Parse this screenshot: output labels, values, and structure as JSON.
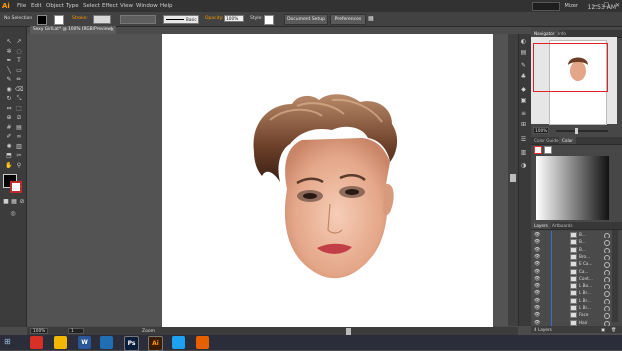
{
  "app": {
    "logo": "Ai",
    "accent": "#ff9a00"
  },
  "menu": [
    "File",
    "Edit",
    "Object",
    "Type",
    "Select",
    "Effect",
    "View",
    "Window",
    "Help"
  ],
  "user": {
    "name": "Mizer",
    "search_icon": "search-icon"
  },
  "window_controls": [
    "—",
    "☐",
    "✕"
  ],
  "control_bar": {
    "selection": "No Selection",
    "stroke_label": "Stroke:",
    "brush_label": "Basic",
    "opacity_label": "Opacity:",
    "opacity_value": "100%",
    "style_label": "Style:",
    "doc_setup": "Document Setup",
    "preferences": "Preferences"
  },
  "document": {
    "tab": "Sexy GirlLat* @ 100% (RGB/Preview)",
    "close": "×"
  },
  "status": {
    "zoom": "100%",
    "page": "1",
    "tool": "Zoom"
  },
  "navigator": {
    "tabs": [
      "Navigator",
      "Info"
    ],
    "zoom": "100%"
  },
  "color_panel": {
    "tabs": [
      "Color Guide",
      "Color"
    ]
  },
  "layers_panel": {
    "tabs": [
      "Layers",
      "Artboards"
    ],
    "rows": [
      {
        "name": "B..."
      },
      {
        "name": "B..."
      },
      {
        "name": "B..."
      },
      {
        "name": "Bro..."
      },
      {
        "name": "E Ca..."
      },
      {
        "name": "Ca..."
      },
      {
        "name": "Cont..."
      },
      {
        "name": "L Bo..."
      },
      {
        "name": "L Br..."
      },
      {
        "name": "L Br..."
      },
      {
        "name": "L Br..."
      },
      {
        "name": "Face"
      },
      {
        "name": "Hair"
      }
    ],
    "footer": "4 Layers"
  },
  "taskbar": {
    "apps": [
      {
        "label": "",
        "color": "#d93025",
        "icon": "chrome-icon"
      },
      {
        "label": "",
        "color": "#f2b705",
        "icon": "folder-icon"
      },
      {
        "label": "W",
        "color": "#2b579a",
        "icon": "word-icon"
      },
      {
        "label": "",
        "color": "#1f6fb2",
        "icon": "ie-icon"
      },
      {
        "label": "Ps",
        "color": "#0a1d3a",
        "icon": "photoshop-icon"
      },
      {
        "label": "Ai",
        "color": "#3b1c00",
        "icon": "illustrator-icon"
      },
      {
        "label": "",
        "color": "#1da1f2",
        "icon": "twitter-icon"
      },
      {
        "label": "",
        "color": "#e66000",
        "icon": "firefox-icon"
      }
    ],
    "clock": "12:53 AM"
  }
}
